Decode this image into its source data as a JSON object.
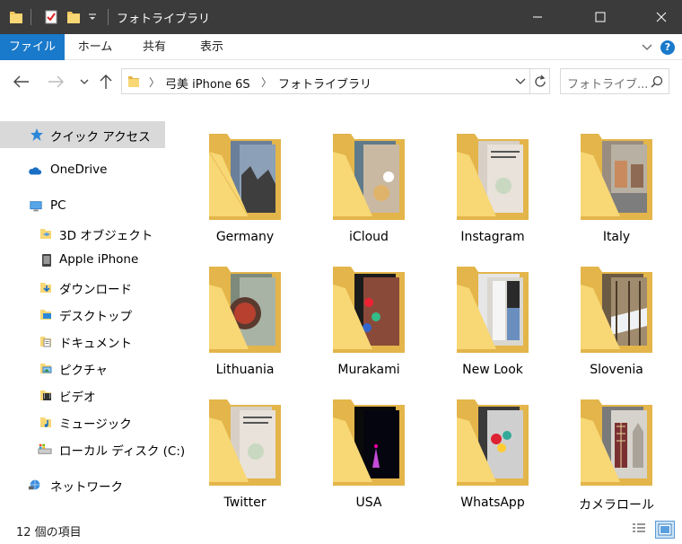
{
  "window": {
    "title": "フォトライブラリ",
    "controls": {
      "minimize": "—",
      "maximize": "☐",
      "close": "✕"
    }
  },
  "ribbon": {
    "tabs": [
      {
        "label": "ファイル",
        "active": true
      },
      {
        "label": "ホーム"
      },
      {
        "label": "共有"
      },
      {
        "label": "表示"
      }
    ],
    "help": "?"
  },
  "address": {
    "breadcrumb": [
      "弓美 iPhone 6S",
      "フォトライブラリ"
    ],
    "search_placeholder": "フォトライブ..."
  },
  "navigation": {
    "items": [
      {
        "label": "クイック アクセス",
        "icon": "star-icon",
        "selected": true
      },
      {
        "label": "OneDrive",
        "icon": "cloud-icon"
      },
      {
        "label": "PC",
        "icon": "computer-icon"
      },
      {
        "label": "3D オブジェクト",
        "icon": "3d-objects-icon"
      },
      {
        "label": "Apple iPhone",
        "icon": "phone-icon"
      },
      {
        "label": "ダウンロード",
        "icon": "download-icon"
      },
      {
        "label": "デスクトップ",
        "icon": "desktop-icon"
      },
      {
        "label": "ドキュメント",
        "icon": "documents-icon"
      },
      {
        "label": "ピクチャ",
        "icon": "pictures-icon"
      },
      {
        "label": "ビデオ",
        "icon": "videos-icon"
      },
      {
        "label": "ミュージック",
        "icon": "music-icon"
      },
      {
        "label": "ローカル ディスク (C:)",
        "icon": "drive-icon"
      },
      {
        "label": "ネットワーク",
        "icon": "network-icon"
      }
    ]
  },
  "folders": [
    {
      "name": "Germany"
    },
    {
      "name": "iCloud"
    },
    {
      "name": "Instagram"
    },
    {
      "name": "Italy"
    },
    {
      "name": "Lithuania"
    },
    {
      "name": "Murakami"
    },
    {
      "name": "New Look"
    },
    {
      "name": "Slovenia"
    },
    {
      "name": "Twitter"
    },
    {
      "name": "USA"
    },
    {
      "name": "WhatsApp"
    },
    {
      "name": "カメラロール"
    }
  ],
  "status": {
    "item_count": "12 個の項目"
  },
  "colors": {
    "titlebar": "#3b3b3b",
    "accent": "#1979ca",
    "folder": "#f8d775",
    "folder_dark": "#e3b54a",
    "selection": "#d9d9d9"
  }
}
